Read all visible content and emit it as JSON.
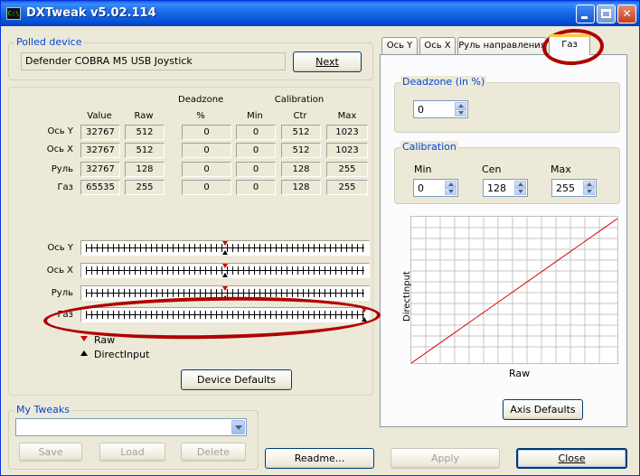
{
  "window": {
    "title": "DXTweak v5.02.114"
  },
  "polled_device": {
    "label": "Polled device",
    "device_name": "Defender COBRA M5 USB Joystick",
    "next_label": "Next"
  },
  "table": {
    "deadzone_header": "Deadzone",
    "calibration_header": "Calibration",
    "columns": [
      "Value",
      "Raw",
      "%",
      "Min",
      "Ctr",
      "Max"
    ],
    "rows": [
      {
        "label": "Ось Y",
        "cells": [
          "32767",
          "512",
          "0",
          "0",
          "512",
          "1023"
        ]
      },
      {
        "label": "Ось X",
        "cells": [
          "32767",
          "512",
          "0",
          "0",
          "512",
          "1023"
        ]
      },
      {
        "label": "Руль",
        "cells": [
          "32767",
          "128",
          "0",
          "0",
          "128",
          "255"
        ]
      },
      {
        "label": "Газ",
        "cells": [
          "65535",
          "255",
          "0",
          "0",
          "128",
          "255"
        ]
      }
    ]
  },
  "sliders": [
    {
      "label": "Ось Y",
      "position": 0.5
    },
    {
      "label": "Ось X",
      "position": 0.5
    },
    {
      "label": "Руль",
      "position": 0.5
    },
    {
      "label": "Газ",
      "position": 1.0
    }
  ],
  "legend": {
    "raw": "Raw",
    "directinput": "DirectInput"
  },
  "device_defaults_label": "Device Defaults",
  "my_tweaks": {
    "label": "My Tweaks",
    "selected": "",
    "save_label": "Save",
    "load_label": "Load",
    "delete_label": "Delete"
  },
  "bottom": {
    "readme_label": "Readme...",
    "apply_label": "Apply",
    "close_label": "Close"
  },
  "tabs": [
    "Ось Y",
    "Ось X",
    "Руль направления",
    "Газ"
  ],
  "axis_panel": {
    "deadzone_label": "Deadzone (in %)",
    "deadzone_value": "0",
    "calibration_label": "Calibration",
    "min_label": "Min",
    "min_value": "0",
    "cen_label": "Cen",
    "cen_value": "128",
    "max_label": "Max",
    "max_value": "255",
    "graph_ylabel": "DirectInput",
    "graph_xlabel": "Raw",
    "axis_defaults_label": "Axis Defaults"
  },
  "colors": {
    "accent": "#0046d5",
    "raw_marker": "#d40000",
    "annotation": "#b00000",
    "curve": "#d40000"
  }
}
